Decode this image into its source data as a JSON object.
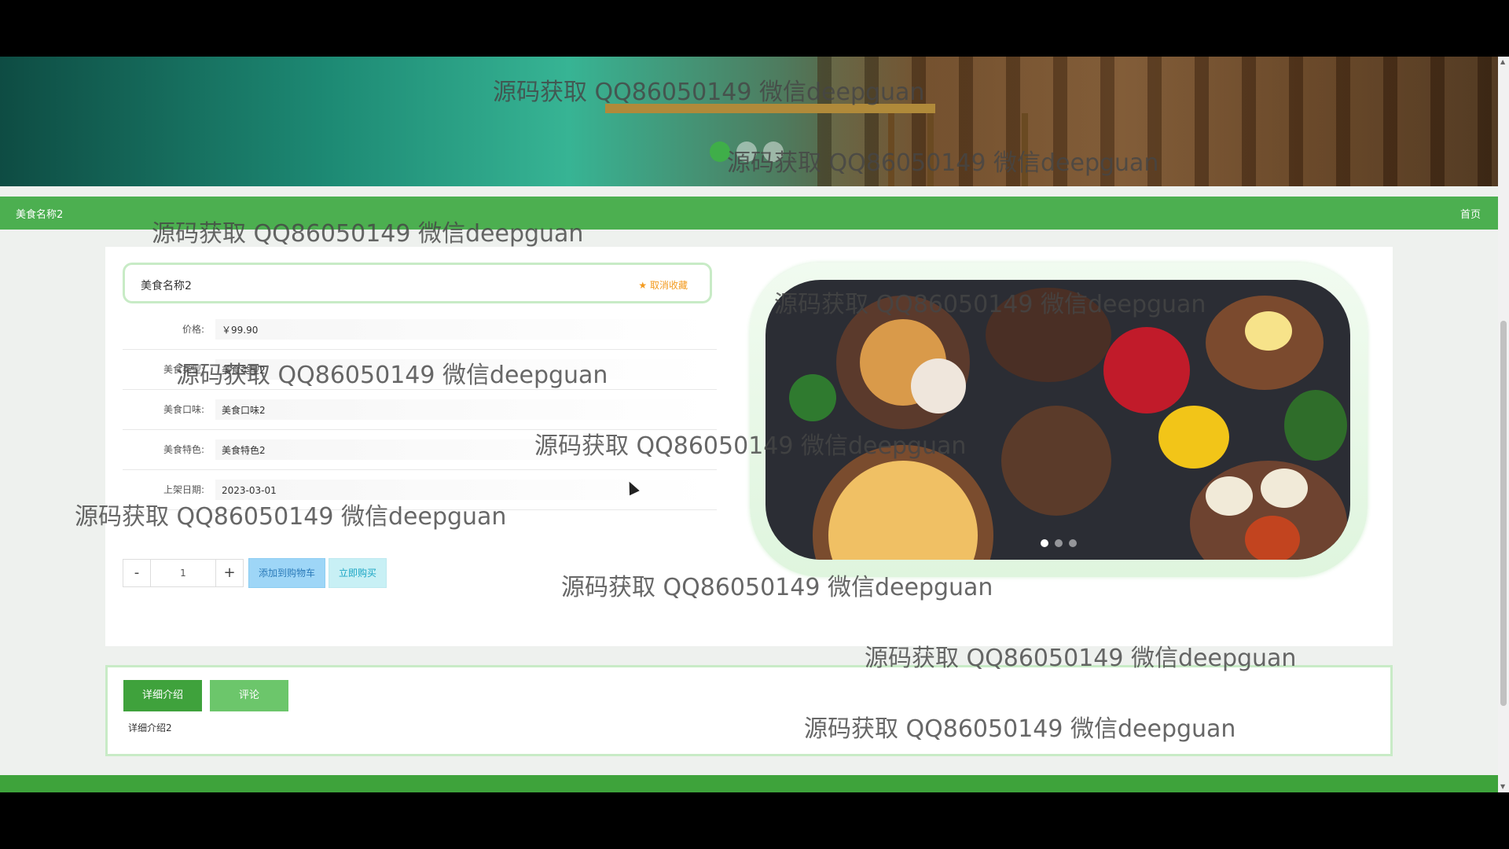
{
  "header": {
    "title": "美食名称2",
    "home_label": "首页"
  },
  "hero": {
    "dots": 3,
    "active_dot": 0
  },
  "product": {
    "name": "美食名称2",
    "favorite_label": "取消收藏",
    "favorite_icon": "star-icon",
    "fields": [
      {
        "label": "价格:",
        "value": "￥99.90"
      },
      {
        "label": "美食类型:",
        "value": "美食类型2"
      },
      {
        "label": "美食口味:",
        "value": "美食口味2"
      },
      {
        "label": "美食特色:",
        "value": "美食特色2"
      },
      {
        "label": "上架日期:",
        "value": "2023-03-01"
      }
    ],
    "quantity": "1",
    "minus_label": "-",
    "plus_label": "+",
    "add_to_cart_label": "添加到购物车",
    "buy_now_label": "立即购买",
    "image_carousel_dots": 3
  },
  "tabs": {
    "items": [
      {
        "label": "详细介绍"
      },
      {
        "label": "评论"
      }
    ],
    "active": 0,
    "content": "详细介绍2"
  },
  "watermarks": [
    "源码获取 QQ86050149 微信deepguan"
  ],
  "colors": {
    "accent": "#4caf50",
    "favorite": "#f39a1e",
    "tab_active": "#3fa23c",
    "tab_inactive": "#6cc66b"
  }
}
